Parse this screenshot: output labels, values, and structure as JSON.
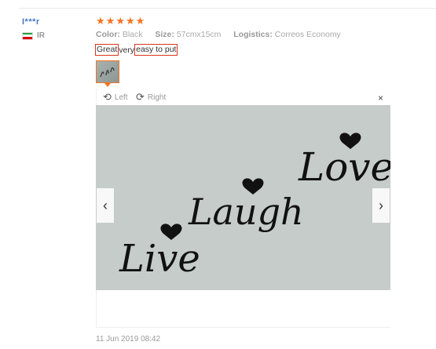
{
  "user": {
    "name": "I***r",
    "country": "IR"
  },
  "rating": {
    "stars": 5,
    "glyph": "★",
    "color": "#f57224"
  },
  "attributes": [
    {
      "key": "Color:",
      "value": "Black"
    },
    {
      "key": "Size:",
      "value": "57cmx15cm"
    },
    {
      "key": "Logistics:",
      "value": "Correos Economy"
    }
  ],
  "review": {
    "part1": "Great",
    "part2": "very",
    "part3": "easy to put"
  },
  "viewer": {
    "rotate_left_label": "Left",
    "rotate_right_label": "Right",
    "close_glyph": "×",
    "prev_glyph": "‹",
    "next_glyph": "›"
  },
  "photo_words": {
    "live": "Live",
    "laugh": "Laugh",
    "love": "Love"
  },
  "date": "11 Jun 2019 08:42"
}
